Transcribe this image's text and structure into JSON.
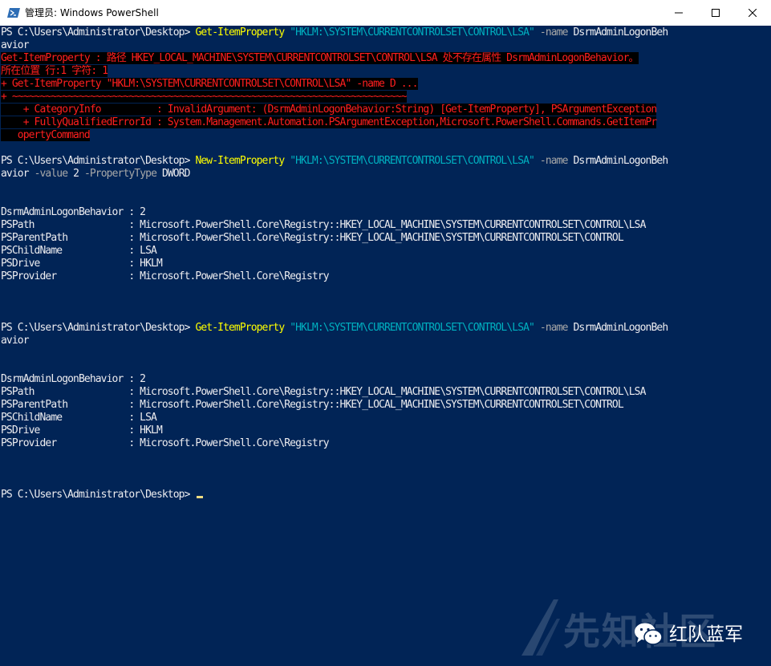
{
  "window": {
    "title": "管理员: Windows PowerShell",
    "minimize_glyph": "—",
    "maximize_glyph": "☐",
    "close_glyph": "✕"
  },
  "prompt": "PS C:\\Users\\Administrator\\Desktop> ",
  "block1": {
    "cmdlet": "Get-ItemProperty",
    "path": "\"HKLM:\\SYSTEM\\CURRENTCONTROLSET\\CONTROL\\LSA\"",
    "param": "-name",
    "value_part1": "DsrmAdminLogonBeh",
    "value_part2": "avior"
  },
  "error": {
    "line1": "Get-ItemProperty : 路径 HKEY_LOCAL_MACHINE\\SYSTEM\\CURRENTCONTROLSET\\CONTROL\\LSA 处不存在属性 DsrmAdminLogonBehavior。",
    "line2": "所在位置 行:1 字符: 1",
    "line3": "+ Get-ItemProperty \"HKLM:\\SYSTEM\\CURRENTCONTROLSET\\CONTROL\\LSA\" -name D ...",
    "line4": "+ ~~~~~~~~~~~~~~~~~~~~~~~~~~~~~~~~~~~~~~~~~~~~~~~~~~~~~~~~~~~~~~~~~~~~~~~",
    "line5": "    + CategoryInfo          : InvalidArgument: (DsrmAdminLogonBehavior:String) [Get-ItemProperty], PSArgumentException",
    "line6": "    + FullyQualifiedErrorId : System.Management.Automation.PSArgumentException,Microsoft.PowerShell.Commands.GetItemPr",
    "line7": "   opertyCommand"
  },
  "block2": {
    "cmdlet": "New-ItemProperty",
    "path": "\"HKLM:\\SYSTEM\\CURRENTCONTROLSET\\CONTROL\\LSA\"",
    "param_name": "-name",
    "value_part1": "DsrmAdminLogonBeh",
    "value_part2": "avior",
    "param_value": "-value",
    "value": "2",
    "param_type": "-PropertyType",
    "type": "DWORD"
  },
  "output1": [
    "DsrmAdminLogonBehavior : 2",
    "PSPath                 : Microsoft.PowerShell.Core\\Registry::HKEY_LOCAL_MACHINE\\SYSTEM\\CURRENTCONTROLSET\\CONTROL\\LSA",
    "PSParentPath           : Microsoft.PowerShell.Core\\Registry::HKEY_LOCAL_MACHINE\\SYSTEM\\CURRENTCONTROLSET\\CONTROL",
    "PSChildName            : LSA",
    "PSDrive                : HKLM",
    "PSProvider             : Microsoft.PowerShell.Core\\Registry"
  ],
  "block3": {
    "cmdlet": "Get-ItemProperty",
    "path": "\"HKLM:\\SYSTEM\\CURRENTCONTROLSET\\CONTROL\\LSA\"",
    "param": "-name",
    "value_part1": "DsrmAdminLogonBeh",
    "value_part2": "avior"
  },
  "output2": [
    "DsrmAdminLogonBehavior : 2",
    "PSPath                 : Microsoft.PowerShell.Core\\Registry::HKEY_LOCAL_MACHINE\\SYSTEM\\CURRENTCONTROLSET\\CONTROL\\LSA",
    "PSParentPath           : Microsoft.PowerShell.Core\\Registry::HKEY_LOCAL_MACHINE\\SYSTEM\\CURRENTCONTROLSET\\CONTROL",
    "PSChildName            : LSA",
    "PSDrive                : HKLM",
    "PSProvider             : Microsoft.PowerShell.Core\\Registry"
  ],
  "watermark": {
    "site_text": "先知社区",
    "account_text": "红队蓝军"
  },
  "icons": {
    "app": "powershell-icon",
    "wechat": "wechat-icon"
  },
  "colors": {
    "console_bg": "#012456",
    "cmdlet": "#ffff00",
    "string": "#00b0c0",
    "parameter": "#a8a8a8",
    "error_fg": "#ff1f1f",
    "error_bg": "#000000",
    "text": "#eeedf0"
  }
}
